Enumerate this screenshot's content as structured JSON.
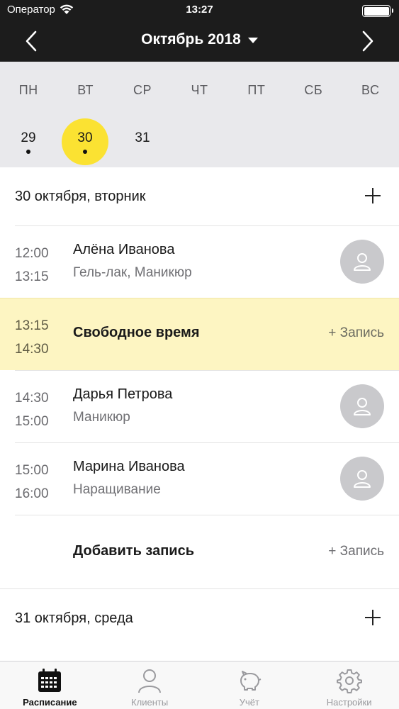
{
  "status": {
    "carrier": "Оператор",
    "time": "13:27"
  },
  "nav": {
    "title": "Октябрь 2018"
  },
  "calendar": {
    "weekdays": [
      "ПН",
      "ВТ",
      "СР",
      "ЧТ",
      "ПТ",
      "СБ",
      "ВС"
    ],
    "days": [
      {
        "label": "29",
        "has_events": true,
        "selected": false
      },
      {
        "label": "30",
        "has_events": true,
        "selected": true
      },
      {
        "label": "31",
        "has_events": false,
        "selected": false
      }
    ]
  },
  "sections": [
    {
      "title": "30 октября, вторник",
      "appointments": [
        {
          "start": "12:00",
          "end": "13:15",
          "client": "Алёна Иванова",
          "service": "Гель-лак, Маникюр"
        },
        {
          "start": "13:15",
          "end": "14:30",
          "free_label": "Свободное время",
          "action": "+ Запись"
        },
        {
          "start": "14:30",
          "end": "15:00",
          "client": "Дарья Петрова",
          "service": "Маникюр"
        },
        {
          "start": "15:00",
          "end": "16:00",
          "client": "Марина Иванова",
          "service": "Наращивание"
        }
      ],
      "add_row": {
        "label": "Добавить запись",
        "action": "+ Запись"
      }
    },
    {
      "title": "31 октября, среда"
    }
  ],
  "tabs": [
    {
      "label": "Расписание",
      "active": true
    },
    {
      "label": "Клиенты",
      "active": false
    },
    {
      "label": "Учёт",
      "active": false
    },
    {
      "label": "Настройки",
      "active": false
    }
  ],
  "colors": {
    "accent": "#fbe232",
    "header": "#1c1c1c",
    "free_slot": "#fdf5c2"
  }
}
